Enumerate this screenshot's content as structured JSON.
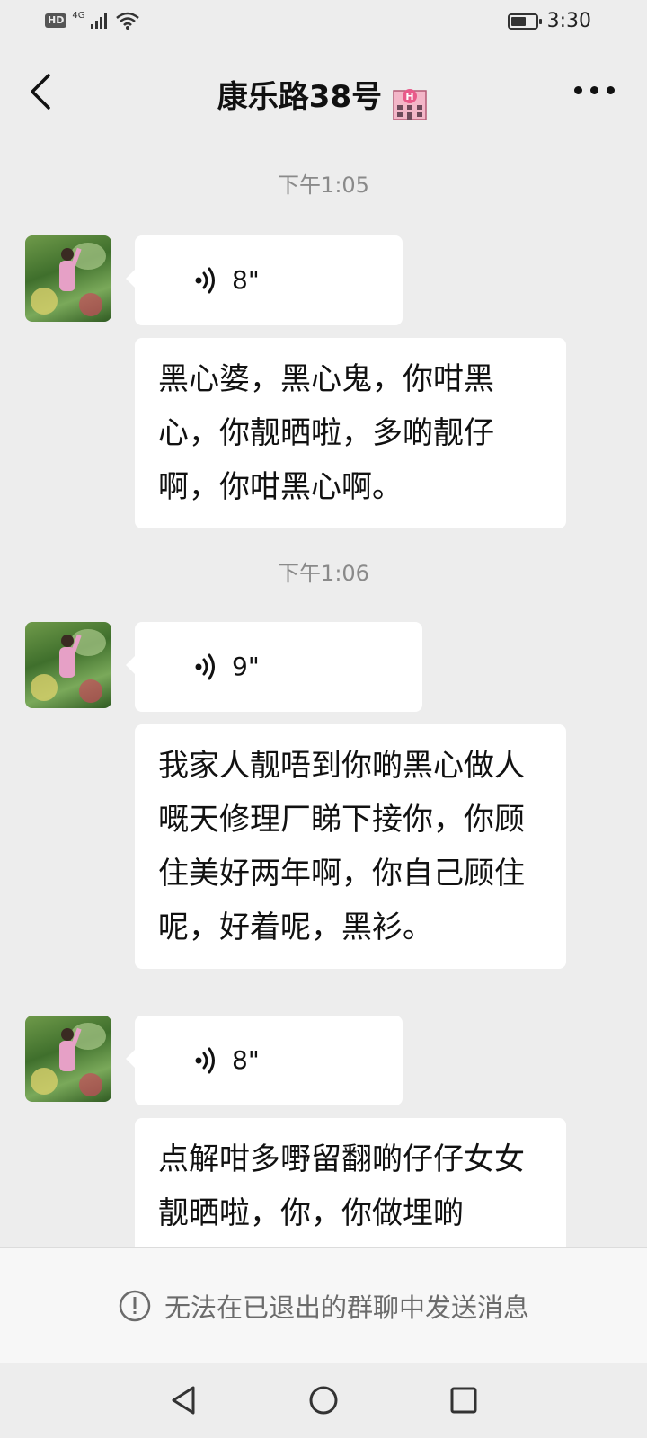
{
  "status_bar": {
    "hd": "HD",
    "network": "4G",
    "time": "3:30"
  },
  "header": {
    "title": "康乐路38号"
  },
  "messages": [
    {
      "time": "下午1:05"
    },
    {
      "voice_duration": "8\""
    },
    {
      "text": "黑心婆，黑心鬼，你咁黑心，你靓晒啦，多啲靓仔啊，你咁黑心啊。"
    },
    {
      "time": "下午1:06"
    },
    {
      "voice_duration": "9\""
    },
    {
      "text": "我家人靓唔到你啲黑心做人嘅天修理厂睇下接你，你顾住美好两年啊，你自己顾住呢，好着呢，黑衫。"
    },
    {
      "voice_duration": "8\""
    },
    {
      "text": "点解咁多嘢留翻啲仔仔女女靓晒啦，你，你做埋啲"
    }
  ],
  "notice": {
    "text": "无法在已退出的群聊中发送消息"
  },
  "colors": {
    "background": "#ededed",
    "bubble": "#ffffff",
    "timestamp": "#8a8a8a",
    "notice_text": "#6b6b6b"
  }
}
